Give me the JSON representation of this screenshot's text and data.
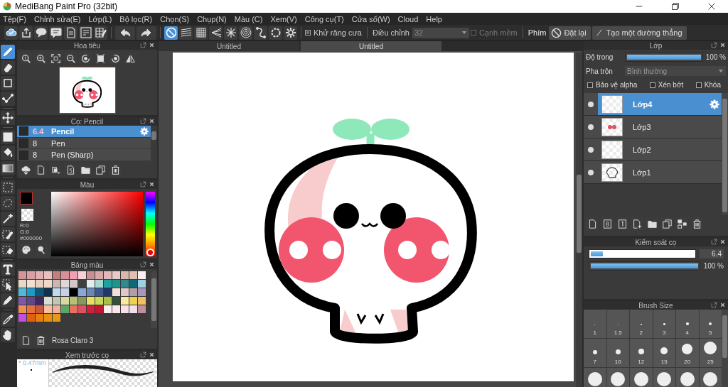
{
  "window": {
    "title": "MediBang Paint Pro (32bit)"
  },
  "menu": [
    "Tệp(F)",
    "Chỉnh sửa(E)",
    "Lớp(L)",
    "Bộ lọc(R)",
    "Chọn(S)",
    "Chụp(N)",
    "Màu (C)",
    "Xem(V)",
    "Công cụ(T)",
    "Cửa sổ(W)",
    "Cloud",
    "Help"
  ],
  "toolbar": {
    "snaps": [
      {
        "kind": "none",
        "selected": true
      },
      {
        "kind": "parallel",
        "selected": false
      },
      {
        "kind": "grid",
        "selected": false
      },
      {
        "kind": "vanish",
        "selected": false
      },
      {
        "kind": "radial",
        "selected": false
      },
      {
        "kind": "concentric",
        "selected": false
      },
      {
        "kind": "curve",
        "selected": false
      },
      {
        "kind": "circle",
        "selected": false
      }
    ],
    "antialias": {
      "label": "Khử răng cưa",
      "checked": true
    },
    "adjust": {
      "label": "Điều chỉnh",
      "value": "32"
    },
    "soft_edge": {
      "label": "Cạnh mềm",
      "checked": false,
      "disabled": true
    },
    "key_label": "Phím",
    "reset_button": "Đặt lại",
    "line_button": "Tạo một đường thẳng"
  },
  "tools": [
    {
      "kind": "brush",
      "selected": true
    },
    {
      "kind": "eraser",
      "selected": false
    },
    {
      "kind": "rect",
      "selected": false
    },
    {
      "kind": "dotline",
      "selected": false
    },
    {
      "kind": "move",
      "selected": false
    },
    {
      "kind": "fill",
      "selected": false
    },
    {
      "kind": "bucket",
      "selected": false
    },
    {
      "kind": "gradient",
      "selected": false
    },
    {
      "kind": "selrect",
      "selected": false
    },
    {
      "kind": "lasso",
      "selected": false
    },
    {
      "kind": "wand",
      "selected": false
    },
    {
      "kind": "selpen",
      "selected": false
    },
    {
      "kind": "selerase",
      "selected": false
    },
    {
      "kind": "text",
      "selected": false
    },
    {
      "kind": "pointer",
      "selected": false
    },
    {
      "kind": "pen",
      "selected": false
    },
    {
      "kind": "dropper",
      "selected": false
    },
    {
      "kind": "hand",
      "selected": false
    }
  ],
  "navigator": {
    "title": "Hoa tiêu"
  },
  "brush_panel": {
    "title": "Cọ: Pencil",
    "brushes": [
      {
        "size": "6.4",
        "name": "Pencil",
        "selected": true
      },
      {
        "size": "8",
        "name": "Pen",
        "selected": false
      },
      {
        "size": "8",
        "name": "Pen (Sharp)",
        "selected": false
      }
    ]
  },
  "color_panel": {
    "title": "Màu",
    "r": "R:0",
    "g": "G:0",
    "hex": "#000000"
  },
  "palette": {
    "title": "Bảng màu",
    "name": "Rosa Claro 3",
    "swatches": [
      {
        "color": "#d4949a"
      },
      {
        "color": "#d8a0a4"
      },
      {
        "color": "#e0b0b4"
      },
      {
        "color": "#e8c0c0"
      },
      {
        "color": "#c08080"
      },
      {
        "color": "#d89098"
      },
      {
        "color": "#f0a0b0"
      },
      {
        "color": "#f8d0d8"
      },
      {
        "color": "#c89090"
      },
      {
        "color": "#d8a8a8"
      },
      {
        "color": "#e0b8b8"
      },
      {
        "color": "#e8c8c8"
      },
      {
        "color": "#d8b8a8"
      },
      {
        "color": "#e0c0b0"
      },
      {
        "color": "#f8f0f0"
      },
      {
        "color": "#e8d8c8"
      },
      {
        "color": "#f0e0d0"
      },
      {
        "color": "#e8d0c0"
      },
      {
        "color": "#f0d8c8"
      },
      {
        "color": "#c8b8b0"
      },
      {
        "color": "#e0d8d8"
      },
      {
        "color": "#d0c8c8"
      },
      {
        "color": "#404040"
      },
      {
        "color": "#e0f0f0"
      },
      {
        "color": "#a8d8d0"
      },
      {
        "color": "#20a0a0"
      },
      {
        "color": "#189890"
      },
      {
        "color": "#308890"
      },
      {
        "color": "#106878"
      },
      {
        "color": "#a0d0e0"
      },
      {
        "color": "#50b8d8"
      },
      {
        "color": "#2098c8"
      },
      {
        "color": "#105878"
      },
      {
        "color": "#103050"
      },
      {
        "color": "#c0d8f0"
      },
      {
        "color": "#c8d0e8"
      },
      {
        "color": "#000000"
      },
      {
        "color": "#88a8d8"
      },
      {
        "color": "#6888b8"
      },
      {
        "color": "#405890"
      },
      {
        "color": "#203868"
      },
      {
        "color": "#f0e0d8"
      },
      {
        "color": "#e0c8c8"
      },
      {
        "color": "#b0a0a0"
      },
      {
        "color": "#a898c0"
      },
      {
        "color": "#8058a8"
      },
      {
        "color": "#604888"
      },
      {
        "color": "#402860"
      },
      {
        "color": "#d8e0d0"
      },
      {
        "color": "#c0c8b0"
      },
      {
        "color": "#d8d8a0"
      },
      {
        "color": "#b8c078"
      },
      {
        "color": "#889860"
      },
      {
        "color": "#e8e060"
      },
      {
        "color": "#c8d858"
      },
      {
        "color": "#a8c048"
      },
      {
        "color": "#305038"
      },
      {
        "color": "#f8e8a0"
      },
      {
        "color": "#f0d050"
      },
      {
        "color": "#f0c060"
      },
      {
        "color": "#f09050"
      },
      {
        "color": "#e87040"
      },
      {
        "color": "#c85840"
      },
      {
        "color": "#f8c0a0"
      },
      {
        "color": "#f0b0a0"
      },
      {
        "color": "#58a868"
      },
      {
        "color": "#e87060"
      },
      {
        "color": "#e05060"
      },
      {
        "color": "#d02040"
      },
      {
        "color": "#c01830"
      },
      {
        "color": "#f8f0f0"
      },
      {
        "color": "#f8e8e8"
      },
      {
        "color": "#f8e0e8"
      },
      {
        "color": "#f0e0f0"
      },
      {
        "color": "#c090a0"
      },
      {
        "color": "#c050e0"
      },
      {
        "color": "#e06010"
      },
      {
        "color": "#e88010"
      },
      {
        "color": "#e89010"
      },
      {
        "color": "#e89818"
      }
    ]
  },
  "brush_preview": {
    "title": "Xem trước cọ",
    "size": "* 0.47mm"
  },
  "tabs": [
    {
      "label": "Untitled",
      "selected": false
    },
    {
      "label": "Untitled",
      "selected": true
    }
  ],
  "layer_panel": {
    "title": "Lớp",
    "opacity_label": "Độ trong",
    "opacity": {
      "level": 1,
      "reading": "100 %"
    },
    "blend_label": "Pha trộn",
    "blend": "Bình thường",
    "options": [
      {
        "label": "Bảo vệ alpha",
        "checked": false
      },
      {
        "label": "Xén bớt",
        "checked": false
      },
      {
        "label": "Khóa",
        "checked": false
      }
    ],
    "layers": [
      {
        "name": "Lớp4",
        "selected": true,
        "visible": true
      },
      {
        "name": "Lớp3",
        "selected": false,
        "visible": true
      },
      {
        "name": "Lớp2",
        "selected": false,
        "visible": true
      },
      {
        "name": "Lớp1",
        "selected": false,
        "visible": true
      }
    ]
  },
  "brush_control": {
    "title": "Kiểm soát cọ",
    "size": {
      "level": 0.12,
      "reading": "6.4"
    },
    "opacity": {
      "level": 1,
      "reading": "100 %"
    }
  },
  "brush_size": {
    "title": "Brush Size",
    "sizes": [
      "1",
      "1.5",
      "2",
      "3",
      "4",
      "5",
      "7",
      "10",
      "12",
      "15",
      "20",
      "25"
    ]
  }
}
